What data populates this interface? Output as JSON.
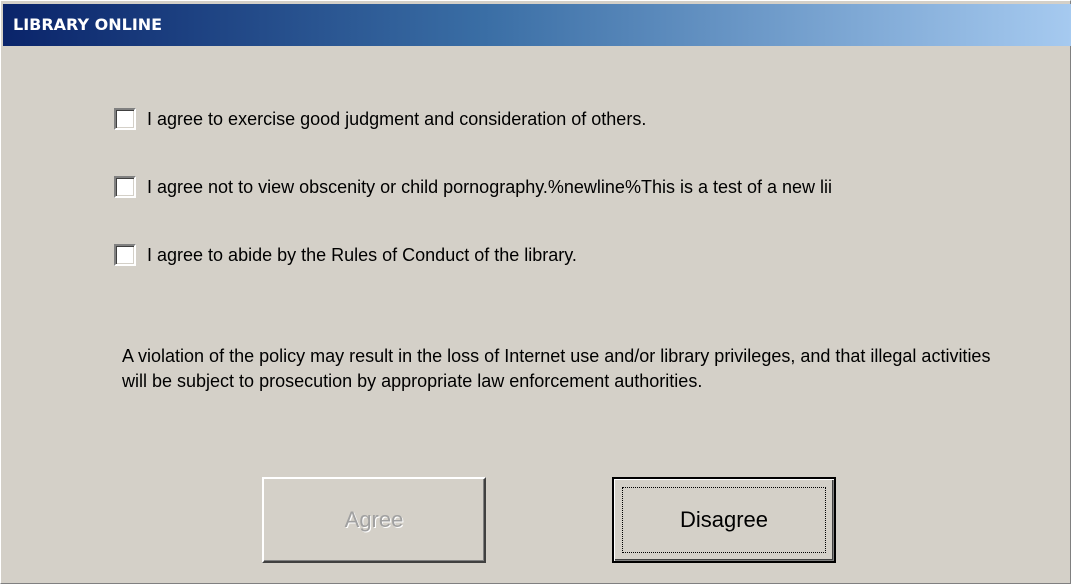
{
  "window": {
    "title": "LIBRARY ONLINE"
  },
  "agreements": [
    {
      "label": "I agree to exercise good judgment and consideration of others.",
      "checked": false
    },
    {
      "label": "I agree not to view obscenity or child pornography.%newline%This is a test of a new lii",
      "checked": false
    },
    {
      "label": "I agree to abide by the Rules of Conduct of the library.",
      "checked": false
    }
  ],
  "policy": {
    "text": "A violation of the policy may result in the loss of Internet use and/or library privileges, and that illegal activities will be subject to prosecution by appropriate law enforcement authorities."
  },
  "buttons": {
    "agree_label": "Agree",
    "agree_enabled": false,
    "disagree_label": "Disagree",
    "disagree_focused": true
  }
}
